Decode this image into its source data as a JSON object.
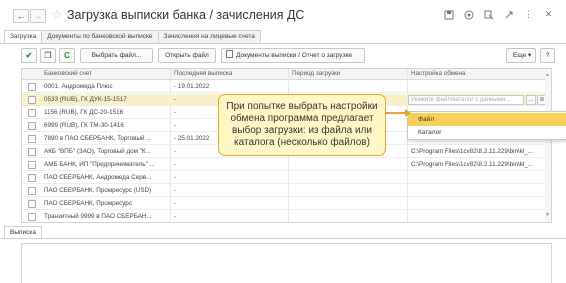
{
  "window": {
    "title": "Загрузка выписки банка / зачисления ДС",
    "back_icon": "←",
    "forward_icon": "→",
    "star_icon": "☆"
  },
  "tabs": [
    {
      "label": "Загрузка",
      "active": true
    },
    {
      "label": "Документы по банковской выписке",
      "active": false
    },
    {
      "label": "Зачисления на лицевые счета",
      "active": false
    }
  ],
  "toolbar": {
    "check_icon": "✔",
    "copy_icon": "❐",
    "refresh_icon": "C",
    "choose_file": "Выбрать файл...",
    "open_file": "Открыть файл",
    "documents": "Документы выписки / Отчет о загрузке",
    "more": "Еще",
    "help": "?"
  },
  "grid": {
    "columns": [
      "Банковский счет",
      "Последняя выписка",
      "Период загрузки",
      "Настройка обмена"
    ],
    "rows": [
      {
        "account": "0001, Андромеда Плюс",
        "last": "- 19.01.2022",
        "period": "",
        "setting": ""
      },
      {
        "account": "0533 (RUB), ГК ДУК-15-1517",
        "last": "-",
        "period": "",
        "setting": "",
        "selected": true
      },
      {
        "account": "1156 (RUB), ГК ДС-20-1516",
        "last": "-",
        "period": "",
        "setting": ""
      },
      {
        "account": "6999 (RUB), ГК ТМ-30-1416",
        "last": "-",
        "period": "",
        "setting": ""
      },
      {
        "account": "7890 в ПАО СБЕРБАНК, Торговый ...",
        "last": "- 25.01.2022",
        "period": "",
        "setting": ""
      },
      {
        "account": "АКБ \"ВПБ\" (ЗАО), Торговый дом \"К...",
        "last": "-",
        "period": "",
        "setting": "C:\\Program Files\\1cv82\\8.2.11.229\\bin\\kl_..."
      },
      {
        "account": "АМБ БАНК, ИП \"Предприниматель\" ...",
        "last": "-",
        "period": "",
        "setting": "C:\\Program Files\\1cv82\\8.2.11.229\\bin\\kl_..."
      },
      {
        "account": "ПАО СБЕРБАНК, Андромеда Серв...",
        "last": "-",
        "period": "",
        "setting": ""
      },
      {
        "account": "ПАО СБЕРБАНК, Промресурс (USD)",
        "last": "-",
        "period": "",
        "setting": ""
      },
      {
        "account": "ПАО СБЕРБАНК, Промресурс",
        "last": "-",
        "period": "",
        "setting": ""
      },
      {
        "account": "Транзитный 9999 в ПАО СБЕРБАН...",
        "last": "-",
        "period": "",
        "setting": ""
      }
    ],
    "setting_placeholder": "Укажите файл/каталог с данными...",
    "ellipsis_btn": "...",
    "link_icon": "⊘"
  },
  "dropdown": {
    "items": [
      "Файл",
      "Каталог"
    ]
  },
  "callout": {
    "text": "При попытке выбрать настройки обмена программа предлагает выбор загрузки: из файла или каталога (несколько файлов)"
  },
  "bottom": {
    "tab": "Выписка"
  },
  "colors": {
    "selected_row": "#fbf1c6",
    "dropdown_hover": "#f7d257",
    "callout_bg": "#fff8c4",
    "callout_border": "#e6a33a"
  }
}
